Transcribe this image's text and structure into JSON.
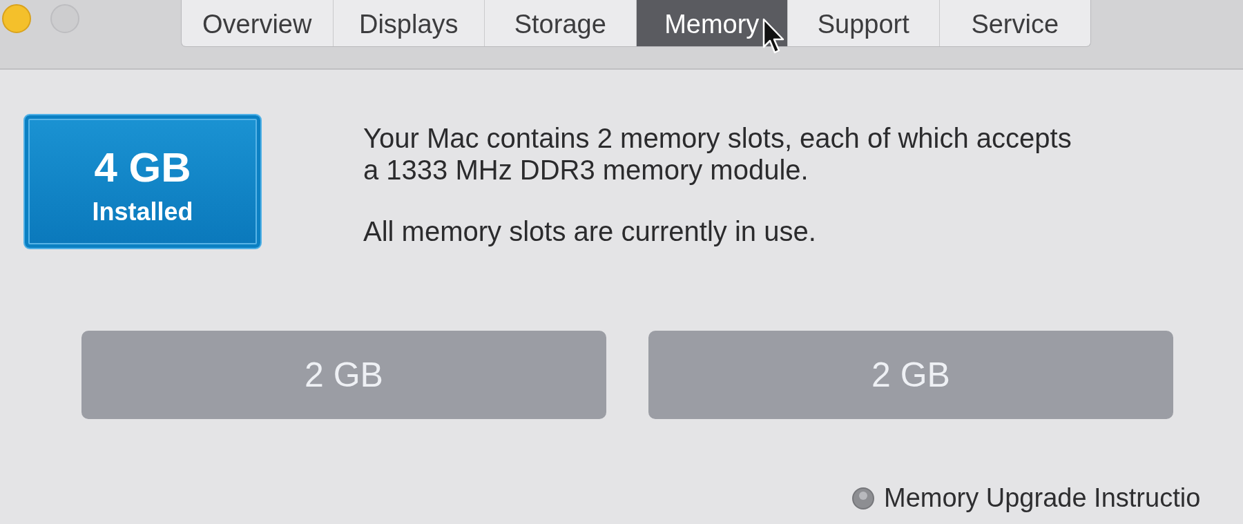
{
  "window": {
    "controls": [
      {
        "kind": "minimize",
        "disabled": false
      },
      {
        "kind": "zoom",
        "disabled": true
      }
    ]
  },
  "tabs": [
    {
      "label": "Overview",
      "selected": false
    },
    {
      "label": "Displays",
      "selected": false
    },
    {
      "label": "Storage",
      "selected": false
    },
    {
      "label": "Memory",
      "selected": true
    },
    {
      "label": "Support",
      "selected": false
    },
    {
      "label": "Service",
      "selected": false
    }
  ],
  "memory": {
    "amount": "4 GB",
    "caption": "Installed",
    "description": [
      "Your Mac contains 2 memory slots, each of which accepts a 1333 MHz DDR3 memory module.",
      "All memory slots are currently in use."
    ],
    "slots": [
      {
        "label": "2 GB"
      },
      {
        "label": "2 GB"
      }
    ]
  },
  "upgrade_link": {
    "label": "Memory Upgrade Instructio"
  }
}
